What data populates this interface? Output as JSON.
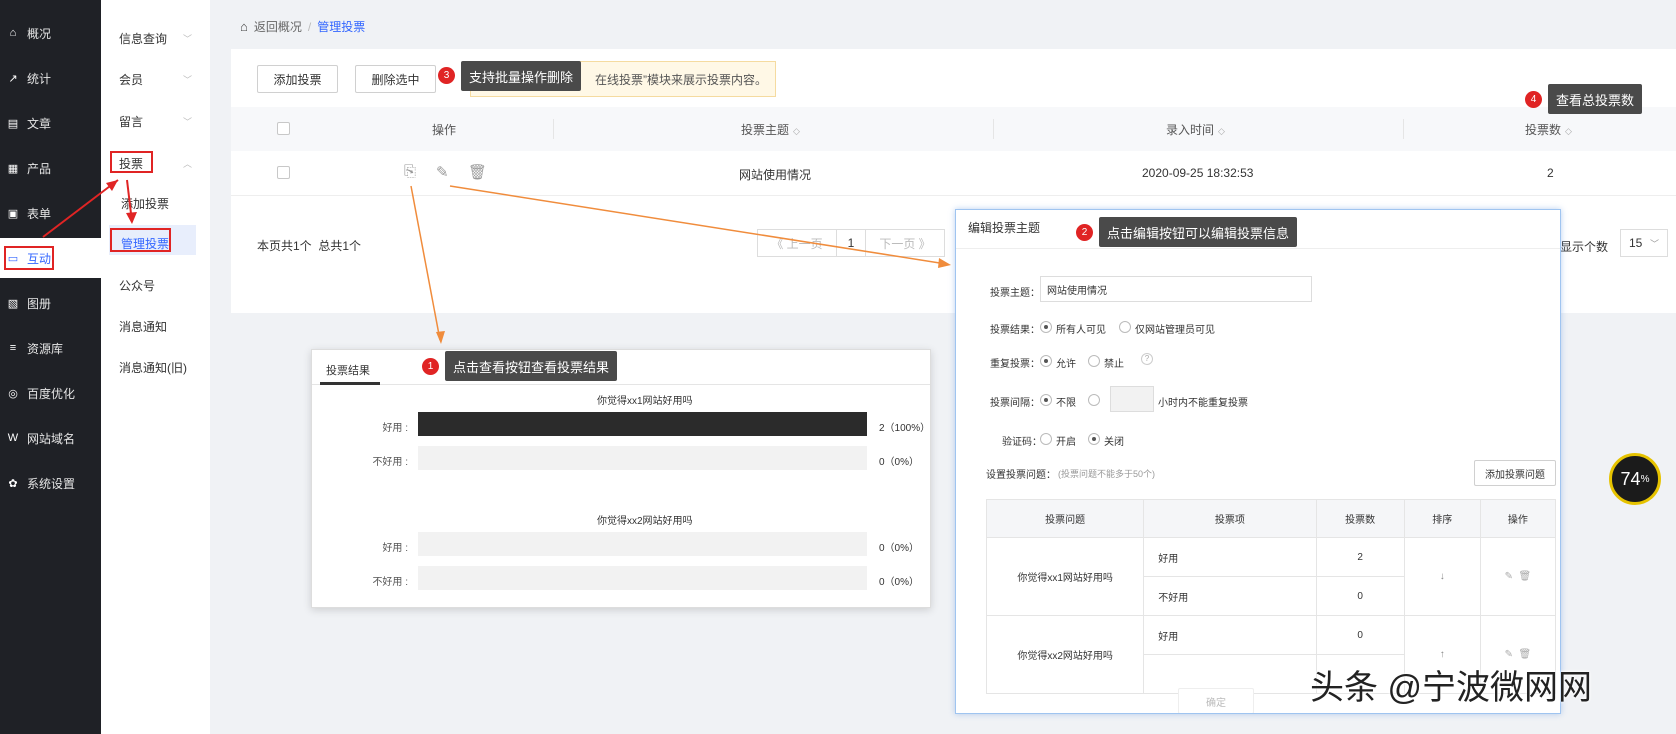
{
  "sidebar": {
    "items": [
      {
        "icon": "home-icon",
        "glyph": "⌂",
        "label": "概况"
      },
      {
        "icon": "chart-icon",
        "glyph": "↗",
        "label": "统计"
      },
      {
        "icon": "article-icon",
        "glyph": "▤",
        "label": "文章"
      },
      {
        "icon": "product-icon",
        "glyph": "▦",
        "label": "产品"
      },
      {
        "icon": "form-icon",
        "glyph": "▣",
        "label": "表单"
      },
      {
        "icon": "interact-icon",
        "glyph": "▭",
        "label": "互动"
      },
      {
        "icon": "album-icon",
        "glyph": "▧",
        "label": "图册"
      },
      {
        "icon": "resource-icon",
        "glyph": "≡",
        "label": "资源库"
      },
      {
        "icon": "seo-icon",
        "glyph": "◎",
        "label": "百度优化"
      },
      {
        "icon": "domain-icon",
        "glyph": "W",
        "label": "网站域名"
      },
      {
        "icon": "settings-icon",
        "glyph": "✿",
        "label": "系统设置"
      }
    ]
  },
  "subnav": {
    "items": [
      "信息查询",
      "会员",
      "留言",
      "投票",
      "添加投票",
      "管理投票",
      "公众号",
      "消息通知",
      "消息通知(旧)"
    ]
  },
  "breadcrumb": {
    "back": "返回概况",
    "sep": "/",
    "current": "管理投票"
  },
  "toolbar": {
    "add_label": "添加投票",
    "delete_label": "删除选中",
    "notice": "在线投票”模块来展示投票内容。"
  },
  "table": {
    "headers": [
      "操作",
      "投票主题",
      "录入时间",
      "投票数"
    ],
    "row": {
      "topic": "网站使用情况",
      "time": "2020-09-25 18:32:53",
      "count": "2"
    }
  },
  "pagination": {
    "summary": "本页共1个  总共1个",
    "prev": "《 上一页",
    "page": "1",
    "next": "下一页 》",
    "per_page_label": "显示个数",
    "per_page_value": "15"
  },
  "annotations": {
    "n1": "1",
    "t1": "点击查看按钮查看投票结果",
    "n2": "2",
    "t2": "点击编辑按钮可以编辑投票信息",
    "n3": "3",
    "t3": "支持批量操作删除",
    "n4": "4",
    "t4": "查看总投票数"
  },
  "result_popup": {
    "tab": "投票结果",
    "questions": [
      {
        "title": "你觉得xx1网站好用吗",
        "options": [
          {
            "label": "好用 :",
            "value": "2（100%）",
            "fraction": 1.0
          },
          {
            "label": "不好用 :",
            "value": "0（0%）",
            "fraction": 0.0
          }
        ]
      },
      {
        "title": "你觉得xx2网站好用吗",
        "options": [
          {
            "label": "好用 :",
            "value": "0（0%）",
            "fraction": 0.0
          },
          {
            "label": "不好用 :",
            "value": "0（0%）",
            "fraction": 0.0
          }
        ]
      }
    ]
  },
  "edit_popup": {
    "title": "编辑投票主题",
    "topic_label": "投票主题：",
    "topic_value": "网站使用情况",
    "result_label": "投票结果：",
    "result_opt1": "所有人可见",
    "result_opt2": "仅网站管理员可见",
    "repeat_label": "重复投票：",
    "repeat_opt1": "允许",
    "repeat_opt2": "禁止",
    "help": "?",
    "interval_label": "投票间隔：",
    "interval_opt1": "不限",
    "interval_suffix": "小时内不能重复投票",
    "captcha_label": "验证码：",
    "captcha_opt1": "开启",
    "captcha_opt2": "关闭",
    "questions_label": "设置投票问题：",
    "questions_hint": "(投票问题不能多于50个)",
    "add_question": "添加投票问题",
    "table_headers": [
      "投票问题",
      "投票项",
      "投票数",
      "排序",
      "操作"
    ],
    "rows": [
      {
        "question": "你觉得xx1网站好用吗",
        "items": [
          {
            "name": "好用",
            "count": "2"
          },
          {
            "name": "不好用",
            "count": "0"
          }
        ],
        "sort": "↓"
      },
      {
        "question": "你觉得xx2网站好用吗",
        "items": [
          {
            "name": "好用",
            "count": "0"
          },
          {
            "name": "",
            "count": ""
          }
        ],
        "sort": "↑"
      }
    ],
    "confirm": "确定"
  },
  "overlay": {
    "gauge": "74",
    "gauge_unit": "%",
    "watermark": "头条 @宁波微网网"
  }
}
